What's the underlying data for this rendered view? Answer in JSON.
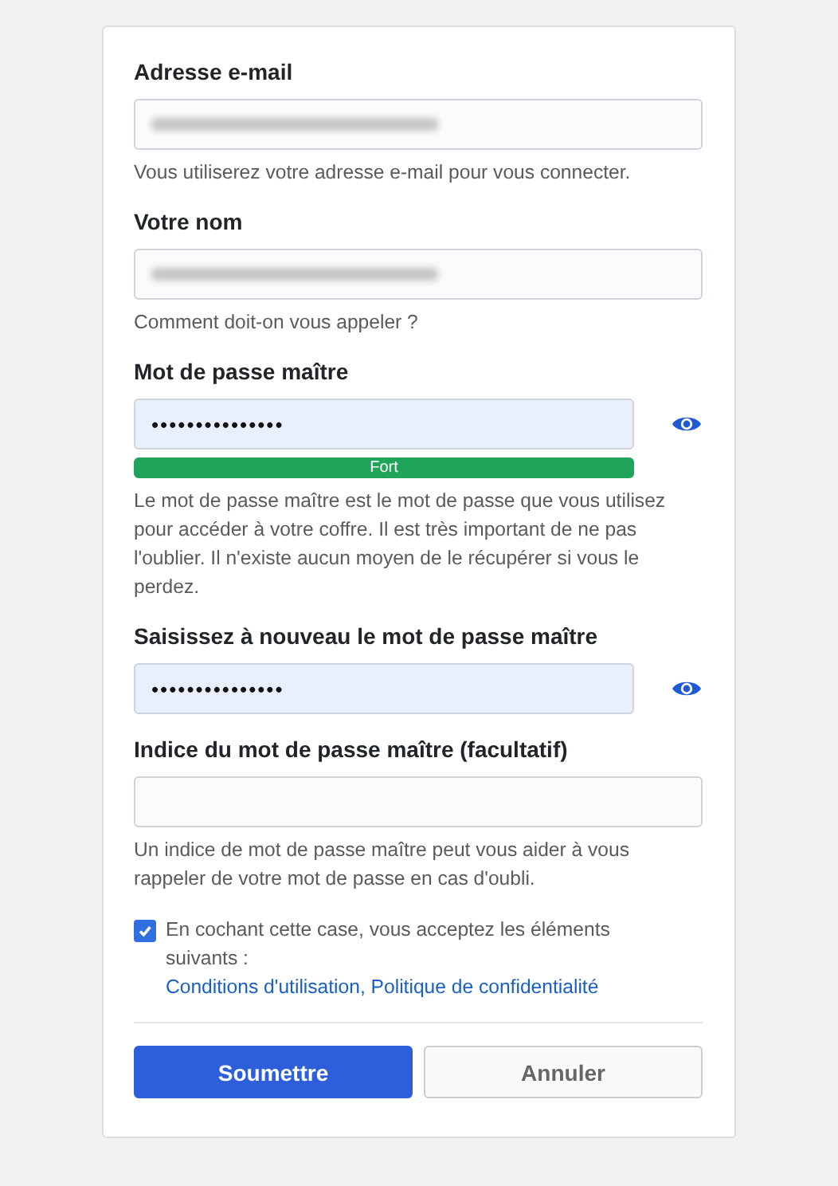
{
  "fields": [
    {
      "kind": "text",
      "label": "Adresse e-mail",
      "redacted": true,
      "help": "Vous utiliserez votre adresse e-mail pour vous connecter."
    },
    {
      "kind": "text",
      "label": "Votre nom",
      "redacted": true,
      "help": "Comment doit-on vous appeler ?"
    },
    {
      "kind": "password",
      "label": "Mot de passe maître",
      "value": "•••••••••••••••",
      "strength": {
        "label": "Fort",
        "level": 1
      },
      "help": "Le mot de passe maître est le mot de passe que vous utilisez pour accéder à votre coffre. Il est très important de ne pas l'oublier. Il n'existe aucun moyen de le récupérer si vous le perdez."
    },
    {
      "kind": "password",
      "label": "Saisissez à nouveau le mot de passe maître",
      "value": "•••••••••••••••"
    },
    {
      "kind": "text",
      "label": "Indice du mot de passe maître (facultatif)",
      "help": "Un indice de mot de passe maître peut vous aider à vous rappeler de votre mot de passe en cas d'oubli."
    }
  ],
  "terms": {
    "checked": true,
    "text": "En cochant cette case, vous acceptez les éléments suivants :",
    "link": "Conditions d'utilisation, Politique de confidentialité"
  },
  "buttons": [
    {
      "kind": "primary",
      "label": "Soumettre"
    },
    {
      "kind": "secondary",
      "label": "Annuler"
    }
  ]
}
